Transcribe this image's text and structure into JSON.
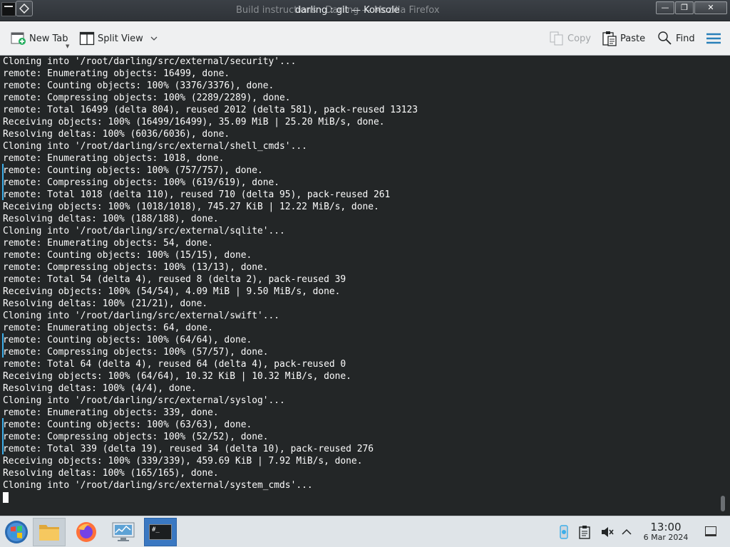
{
  "window": {
    "title_background": "Build instructions · Darling — Mozilla Firefox",
    "title": "darling : git — Konsole",
    "min_glyph": "—",
    "max_glyph": "❐",
    "close_glyph": "✕"
  },
  "toolbar": {
    "new_tab_label": "New Tab",
    "split_view_label": "Split View",
    "copy_label": "Copy",
    "paste_label": "Paste",
    "find_label": "Find"
  },
  "terminal": {
    "lines": [
      "Cloning into '/root/darling/src/external/security'...",
      "remote: Enumerating objects: 16499, done.",
      "remote: Counting objects: 100% (3376/3376), done.",
      "remote: Compressing objects: 100% (2289/2289), done.",
      "remote: Total 16499 (delta 804), reused 2012 (delta 581), pack-reused 13123",
      "Receiving objects: 100% (16499/16499), 35.09 MiB | 25.20 MiB/s, done.",
      "Resolving deltas: 100% (6036/6036), done.",
      "Cloning into '/root/darling/src/external/shell_cmds'...",
      "remote: Enumerating objects: 1018, done.",
      "remote: Counting objects: 100% (757/757), done.",
      "remote: Compressing objects: 100% (619/619), done.",
      "remote: Total 1018 (delta 110), reused 710 (delta 95), pack-reused 261",
      "Receiving objects: 100% (1018/1018), 745.27 KiB | 12.22 MiB/s, done.",
      "Resolving deltas: 100% (188/188), done.",
      "Cloning into '/root/darling/src/external/sqlite'...",
      "remote: Enumerating objects: 54, done.",
      "remote: Counting objects: 100% (15/15), done.",
      "remote: Compressing objects: 100% (13/13), done.",
      "remote: Total 54 (delta 4), reused 8 (delta 2), pack-reused 39",
      "Receiving objects: 100% (54/54), 4.09 MiB | 9.50 MiB/s, done.",
      "Resolving deltas: 100% (21/21), done.",
      "Cloning into '/root/darling/src/external/swift'...",
      "remote: Enumerating objects: 64, done.",
      "remote: Counting objects: 100% (64/64), done.",
      "remote: Compressing objects: 100% (57/57), done.",
      "remote: Total 64 (delta 4), reused 64 (delta 4), pack-reused 0",
      "Receiving objects: 100% (64/64), 10.32 KiB | 10.32 MiB/s, done.",
      "Resolving deltas: 100% (4/4), done.",
      "Cloning into '/root/darling/src/external/syslog'...",
      "remote: Enumerating objects: 339, done.",
      "remote: Counting objects: 100% (63/63), done.",
      "remote: Compressing objects: 100% (52/52), done.",
      "remote: Total 339 (delta 19), reused 34 (delta 10), pack-reused 276",
      "Receiving objects: 100% (339/339), 459.69 KiB | 7.92 MiB/s, done.",
      "Resolving deltas: 100% (165/165), done.",
      "Cloning into '/root/darling/src/external/system_cmds'..."
    ],
    "background": "#232627",
    "foreground": "#fcfcfc"
  },
  "taskbar": {
    "clock_time": "13:00",
    "clock_date": "6 Mar 2024",
    "konsole_icon_text": "#_",
    "icons": [
      "start-menu-icon",
      "file-manager-icon",
      "firefox-icon",
      "system-monitor-icon",
      "konsole-icon",
      "kde-connect-icon",
      "clipboard-icon",
      "volume-muted-icon",
      "tray-expand-icon",
      "show-desktop-icon"
    ]
  }
}
